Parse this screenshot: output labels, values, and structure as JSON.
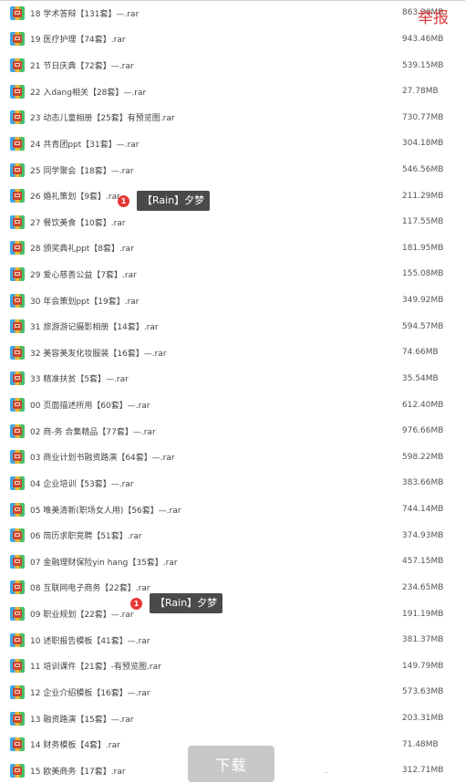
{
  "report_label": "举报",
  "download_label": "下载",
  "tips": [
    {
      "badge": "1",
      "text": "【Rain】夕梦"
    },
    {
      "badge": "1",
      "text": "【Rain】夕梦"
    }
  ],
  "files": [
    {
      "name": "18 学术答辩【131套】—.rar",
      "size": "863.36MB"
    },
    {
      "name": "19 医疗护理【74套】.rar",
      "size": "943.46MB"
    },
    {
      "name": "21 节日庆典【72套】—.rar",
      "size": "539.15MB"
    },
    {
      "name": "22 入dang相关【28套】—.rar",
      "size": "27.78MB"
    },
    {
      "name": "23 动态儿童相册【25套】有预览图.rar",
      "size": "730.77MB"
    },
    {
      "name": "24 共青团ppt【31套】—.rar",
      "size": "304.18MB"
    },
    {
      "name": "25 同学聚会【18套】—.rar",
      "size": "546.56MB"
    },
    {
      "name": "26 婚礼策划【9套】.rar",
      "size": "211.29MB"
    },
    {
      "name": "27 餐饮美食【10套】.rar",
      "size": "117.55MB"
    },
    {
      "name": "28 颁奖典礼ppt【8套】.rar",
      "size": "181.95MB"
    },
    {
      "name": "29 爱心慈善公益【7套】.rar",
      "size": "155.08MB"
    },
    {
      "name": "30 年会策划ppt【19套】.rar",
      "size": "349.92MB"
    },
    {
      "name": "31 旅游游记摄影相册【14套】.rar",
      "size": "594.57MB"
    },
    {
      "name": "32 美容美发化妆服装【16套】—.rar",
      "size": "74.66MB"
    },
    {
      "name": "33 精准扶贫【5套】—.rar",
      "size": "35.54MB"
    },
    {
      "name": "00 页面描述所用【60套】—.rar",
      "size": "612.40MB"
    },
    {
      "name": "02 商-务 合集精品【77套】—.rar",
      "size": "976.66MB"
    },
    {
      "name": "03 商业计划书融资路演【64套】—.rar",
      "size": "598.22MB"
    },
    {
      "name": "04 企业培训【53套】—.rar",
      "size": "383.66MB"
    },
    {
      "name": "05 唯美清新(职场女人用)【56套】—.rar",
      "size": "744.14MB"
    },
    {
      "name": "06 简历求职竞聘【51套】.rar",
      "size": "374.93MB"
    },
    {
      "name": "07 金融理财保险yin hang【35套】.rar",
      "size": "457.15MB"
    },
    {
      "name": "08 互联网电子商务【22套】.rar",
      "size": "234.65MB"
    },
    {
      "name": "09 职业规划【22套】—.rar",
      "size": "191.19MB"
    },
    {
      "name": "10 述职报告模板【41套】—.rar",
      "size": "381.37MB"
    },
    {
      "name": "11 培训课件【21套】-有预览图.rar",
      "size": "149.79MB"
    },
    {
      "name": "12 企业介绍模板【16套】—.rar",
      "size": "573.63MB"
    },
    {
      "name": "13 融资路演【15套】—.rar",
      "size": "203.31MB"
    },
    {
      "name": "14 财务模板【4套】.rar",
      "size": "71.48MB"
    },
    {
      "name": "15 欧美商务【17套】.rar",
      "size": "312.71MB"
    }
  ]
}
